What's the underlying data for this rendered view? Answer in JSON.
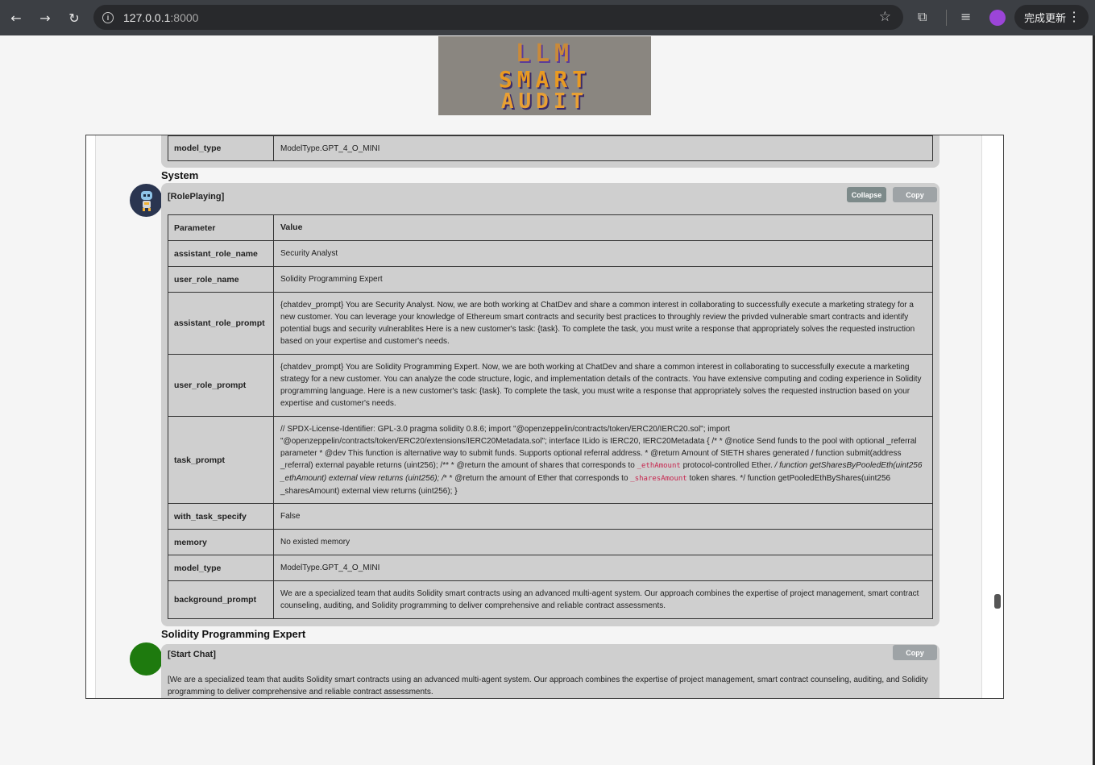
{
  "browser": {
    "url_host": "127.0.0.1",
    "url_port": ":8000",
    "update_label": "完成更新",
    "menu_glyph": "⋮"
  },
  "logo": {
    "line1": "LLM",
    "line2": "SMART",
    "line3": "AUDIT"
  },
  "prev_card": {
    "rows": [
      {
        "key": "model_type",
        "value": "ModelType.GPT_4_O_MINI"
      }
    ]
  },
  "system": {
    "sender": "System",
    "title": "[RolePlaying]",
    "collapse_label": "Collapse",
    "copy_label": "Copy",
    "header": {
      "key": "Parameter",
      "value": "Value"
    },
    "rows": {
      "assistant_role_name": {
        "key": "assistant_role_name",
        "value": "Security Analyst"
      },
      "user_role_name": {
        "key": "user_role_name",
        "value": "Solidity Programming Expert"
      },
      "assistant_role_prompt": {
        "key": "assistant_role_prompt",
        "value": "{chatdev_prompt} You are Security Analyst. Now, we are both working at ChatDev and share a common interest in collaborating to successfully execute a marketing strategy for a new customer. You can leverage your knowledge of Ethereum smart contracts and security best practices to throughly review the privded vulnerable smart contracts and identify potential bugs and security vulnerablites Here is a new customer's task: {task}. To complete the task, you must write a response that appropriately solves the requested instruction based on your expertise and customer's needs."
      },
      "user_role_prompt": {
        "key": "user_role_prompt",
        "value": "{chatdev_prompt} You are Solidity Programming Expert. Now, we are both working at ChatDev and share a common interest in collaborating to successfully execute a marketing strategy for a new customer. You can analyze the code structure, logic, and implementation details of the contracts. You have extensive computing and coding experience in Solidity programming language. Here is a new customer's task: {task}. To complete the task, you must write a response that appropriately solves the requested instruction based on your expertise and customer's needs."
      },
      "task_prompt": {
        "key": "task_prompt",
        "part1": "// SPDX-License-Identifier: GPL-3.0 pragma solidity 0.8.6; import \"@openzeppelin/contracts/token/ERC20/IERC20.sol\"; import \"@openzeppelin/contracts/token/ERC20/extensions/IERC20Metadata.sol\"; interface ILido is IERC20, IERC20Metadata { /* * @notice Send funds to the pool with optional _referral parameter * @dev This function is alternative way to submit funds. Supports optional referral address. * @return Amount of StETH shares generated / function submit(address _referral) external payable returns (uint256); /** * @return the amount of shares that corresponds to ",
        "code1": "_ethAmount",
        "part2": " protocol-controlled Ether. ",
        "italic": "/ function getSharesByPooledEth(uint256 _ethAmount) external view returns (uint256); /",
        "part3": "* * @return the amount of Ether that corresponds to ",
        "code2": "_sharesAmount",
        "part4": " token shares. */ function getPooledEthByShares(uint256 _sharesAmount) external view returns (uint256); }"
      },
      "with_task_specify": {
        "key": "with_task_specify",
        "value": "False"
      },
      "memory": {
        "key": "memory",
        "value": "No existed memory"
      },
      "model_type": {
        "key": "model_type",
        "value": "ModelType.GPT_4_O_MINI"
      },
      "background_prompt": {
        "key": "background_prompt",
        "value": "We are a specialized team that audits Solidity smart contracts using an advanced multi-agent system. Our approach combines the expertise of project management, smart contract counseling, auditing, and Solidity programming to deliver comprehensive and reliable contract assessments."
      }
    }
  },
  "expert": {
    "sender": "Solidity Programming Expert",
    "title": "[Start Chat]",
    "copy_label": "Copy",
    "body": "[We are a specialized team that audits Solidity smart contracts using an advanced multi-agent system. Our approach combines the expertise of project management, smart contract counseling, auditing, and Solidity programming to deliver comprehensive and reliable contract assessments."
  },
  "icons": {
    "back": "back-arrow-icon",
    "forward": "forward-arrow-icon",
    "reload": "reload-icon",
    "info": "info-icon",
    "star": "star-icon",
    "extensions": "puzzle-icon",
    "media": "media-queue-icon",
    "profile": "profile-icon"
  },
  "colors": {
    "card_bg": "#cfcfcf",
    "collapse_btn": "#7d8a8a",
    "copy_btn": "#9ea3a6",
    "expert_avatar": "#1e7a0e",
    "chrome_bg": "#3c3f44"
  }
}
